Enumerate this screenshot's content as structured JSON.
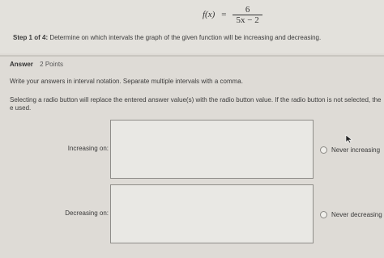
{
  "problem": {
    "function_lhs": "f(x)",
    "equals": "=",
    "numerator": "6",
    "denominator": "5x − 2"
  },
  "step": {
    "label": "Step 1 of 4:",
    "text": "Determine on which intervals the graph of the given function will be increasing and decreasing."
  },
  "answer": {
    "label": "Answer",
    "points": "2 Points",
    "instruction": "Write your answers in interval notation. Separate multiple intervals with a comma.",
    "radio_note": "Selecting a radio button will replace the entered answer value(s) with the radio button value. If the radio button is not selected, the e used."
  },
  "rows": {
    "increasing": {
      "label": "Increasing on:",
      "value": "",
      "radio_label": "Never increasing"
    },
    "decreasing": {
      "label": "Decreasing on:",
      "value": "",
      "radio_label": "Never decreasing"
    }
  },
  "icons": {
    "cursor": "mouse-pointer-icon"
  }
}
